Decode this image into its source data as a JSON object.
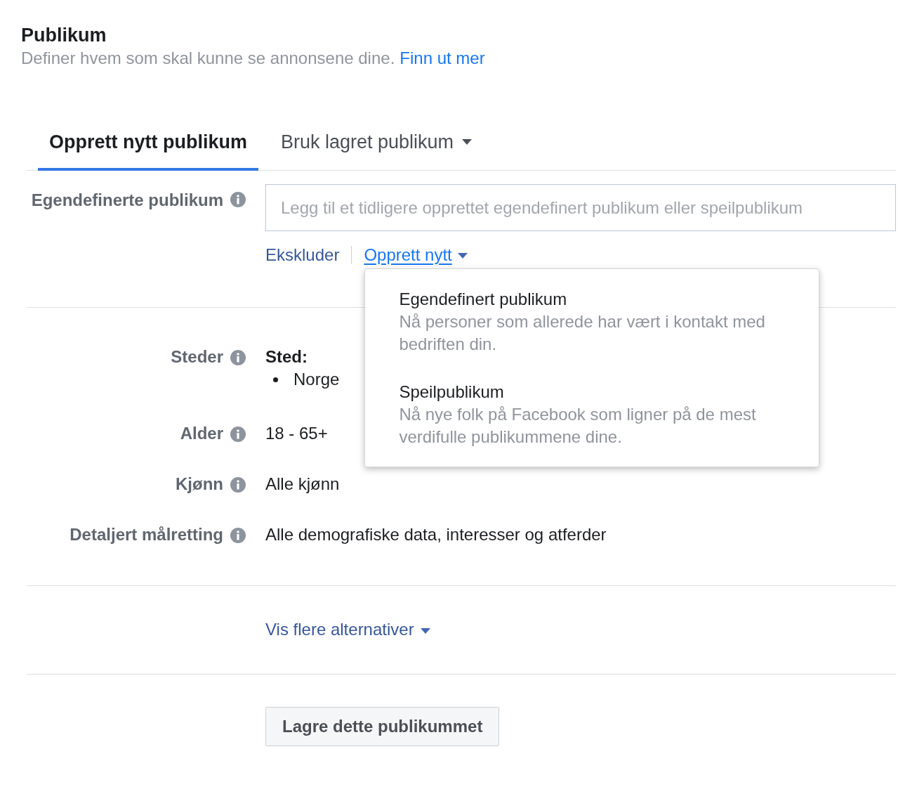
{
  "header": {
    "title": "Publikum",
    "description": "Definer hvem som skal kunne se annonsene dine.",
    "link": "Finn ut mer"
  },
  "tabs": [
    {
      "label": "Opprett nytt publikum",
      "selected": true,
      "caret": false
    },
    {
      "label": "Bruk lagret publikum",
      "selected": false,
      "caret": true
    }
  ],
  "custom_audiences": {
    "label": "Egendefinerte publikum",
    "input": {
      "placeholder": "Legg til et tidligere opprettet egendefinert publikum eller speilpublikum"
    },
    "actions": [
      {
        "kind": "link",
        "label": "Ekskluder"
      },
      {
        "kind": "menu",
        "label": "Opprett nytt",
        "expanded": true,
        "menu": [
          {
            "title": "Egendefinert publikum",
            "description": "Nå personer som allerede har vært i kontakt med bedriften din."
          },
          {
            "title": "Speilpublikum",
            "description": "Nå nye folk på Facebook som ligner på de mest verdifulle publikummene dine."
          }
        ]
      }
    ]
  },
  "targeting": [
    {
      "kind": "list",
      "label": "Steder",
      "heading": "Sted:",
      "items": [
        "Norge"
      ]
    },
    {
      "kind": "text",
      "label": "Alder",
      "value": "18 - 65+"
    },
    {
      "kind": "text",
      "label": "Kjønn",
      "value": "Alle kjønn"
    },
    {
      "kind": "text",
      "label": "Detaljert målretting",
      "value": "Alle demografiske data, interesser og atferder"
    }
  ],
  "more_options": {
    "label": "Vis flere alternativer"
  },
  "save_button": {
    "label": "Lagre dette publikummet"
  }
}
